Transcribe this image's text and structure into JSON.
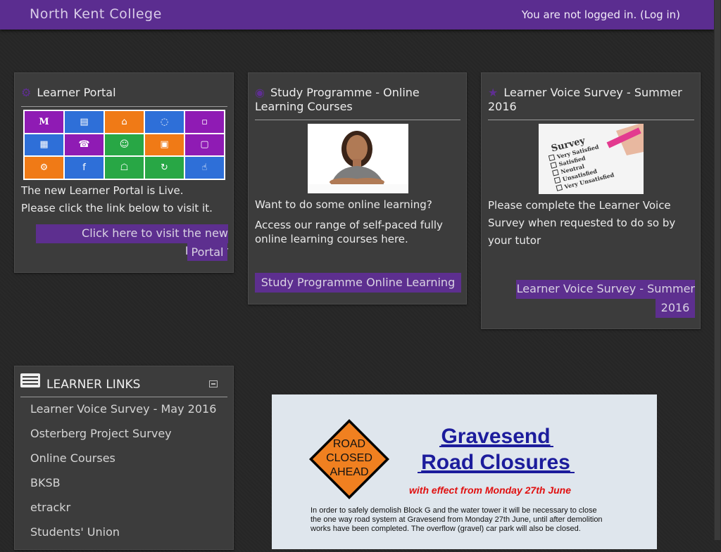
{
  "header": {
    "site_name": "North Kent College",
    "login_status": "You are not logged in.",
    "login_link": "(Log in)"
  },
  "cards": [
    {
      "title": "Learner Portal",
      "icon": "gear-icon",
      "lines": [
        "The new Learner Portal is Live.",
        "Please click the link below to visit it."
      ],
      "button_line1": "Click here to visit the new Learner",
      "button_line2": "Portal",
      "tiles": [
        {
          "color": "#8f1bb4",
          "glyph": "M"
        },
        {
          "color": "#2e6fd8",
          "glyph": "▤"
        },
        {
          "color": "#f07a16",
          "glyph": "⌂"
        },
        {
          "color": "#2e6fd8",
          "glyph": "◌"
        },
        {
          "color": "#8f1bb4",
          "glyph": "▫"
        },
        {
          "color": "#2e6fd8",
          "glyph": "▦"
        },
        {
          "color": "#8f1bb4",
          "glyph": "☎"
        },
        {
          "color": "#28a745",
          "glyph": "☺"
        },
        {
          "color": "#f07a16",
          "glyph": "▣"
        },
        {
          "color": "#8f1bb4",
          "glyph": "▢"
        },
        {
          "color": "#f07a16",
          "glyph": "⚙"
        },
        {
          "color": "#2e6fd8",
          "glyph": "f"
        },
        {
          "color": "#28a745",
          "glyph": "☖"
        },
        {
          "color": "#28a745",
          "glyph": "↻"
        },
        {
          "color": "#2e6fd8",
          "glyph": "☝"
        }
      ]
    },
    {
      "title_line1": "Study Programme - Online",
      "title_line2": "Learning Courses",
      "icon": "people-icon",
      "lines": [
        "Want to do some online learning?",
        "Access our range of self-paced fully",
        "online learning courses here."
      ],
      "button": "Study Programme Online Learning"
    },
    {
      "title_line1": "Learner Voice Survey - Summer",
      "title_line2": "2016",
      "icon": "star-icon",
      "lines": [
        "Please complete the Learner Voice",
        "Survey when requested to do so by",
        "your tutor"
      ],
      "button_line1": "Learner Voice Survey - Summer",
      "button_line2": "2016",
      "survey": {
        "title": "Survey",
        "options": [
          "Very Satisfied",
          "Satisfied",
          "Neutral",
          "Unsatisfied",
          "Very Unsatisfied"
        ]
      }
    }
  ],
  "learner_links": {
    "title": "LEARNER LINKS",
    "items": [
      "Learner Voice Survey - May 2016",
      "Osterberg Project Survey",
      "Online Courses",
      "BKSB",
      "etrackr",
      "Students' Union"
    ]
  },
  "notice": {
    "sign_line1": "ROAD",
    "sign_line2": "CLOSED",
    "sign_line3": "AHEAD",
    "title_line1": "Gravesend",
    "title_line2": "Road Closures",
    "subtitle": "with effect from Monday 27th June",
    "body_line1": "In order to safely demolish Block G and the water tower it will be necessary to close",
    "body_line2": "the one way road system at Gravesend from Monday 27th June, until after demolition",
    "body_line3": "works have been completed. The overflow (gravel) car park will also be closed."
  }
}
